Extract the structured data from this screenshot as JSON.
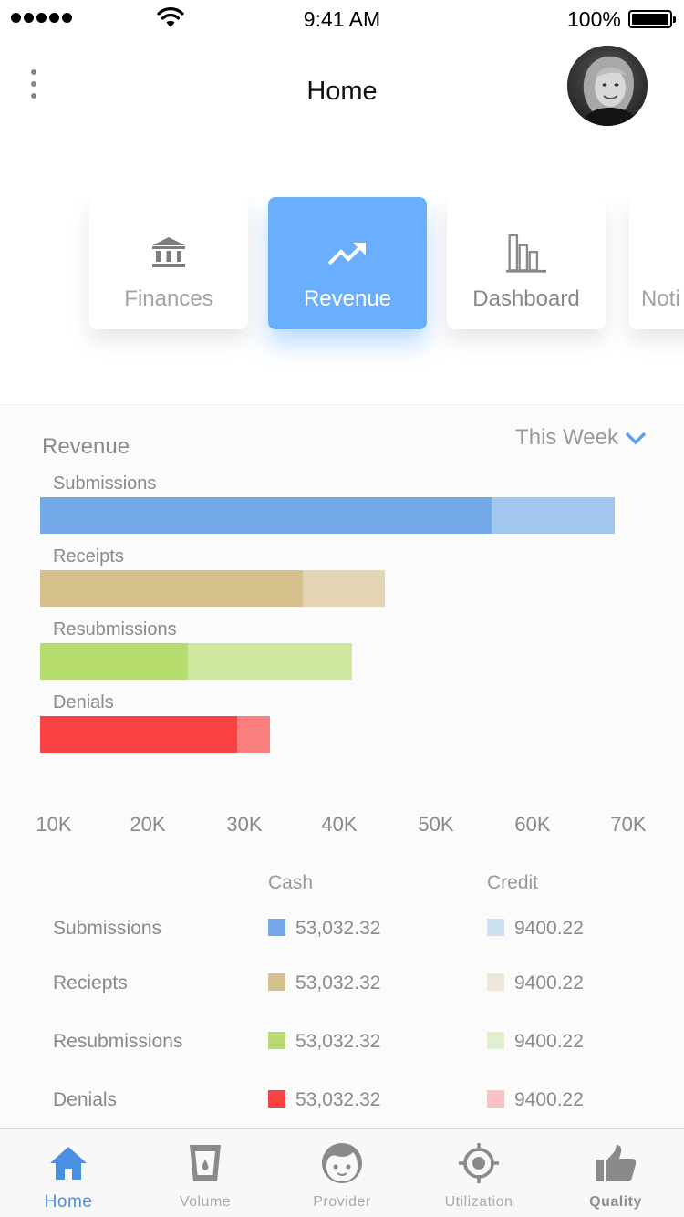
{
  "status_bar": {
    "time": "9:41 AM",
    "battery": "100%"
  },
  "header": {
    "title": "Home"
  },
  "categories": [
    {
      "label": "Finances",
      "icon": "bank-icon",
      "active": false
    },
    {
      "label": "Revenue",
      "icon": "trending-up-icon",
      "active": true
    },
    {
      "label": "Dashboard",
      "icon": "bar-chart-icon",
      "active": false
    },
    {
      "label": "Noti",
      "icon": "",
      "active": false
    }
  ],
  "panel": {
    "title": "Revenue",
    "period": "This Week"
  },
  "chart_data": {
    "type": "bar",
    "orientation": "horizontal",
    "stacked": true,
    "categories": [
      "Submissions",
      "Receipts",
      "Resubmissions",
      "Denials"
    ],
    "series": [
      {
        "name": "Cash",
        "values": [
          55,
          32,
          18,
          24
        ]
      },
      {
        "name": "Credit",
        "values": [
          15,
          10,
          20,
          4
        ]
      }
    ],
    "x_ticks": [
      "10K",
      "20K",
      "30K",
      "40K",
      "50K",
      "60K",
      "70K"
    ],
    "colors": {
      "cash": [
        "#74a9e8",
        "#d6c08c",
        "#b5dc6d",
        "#fb4242"
      ],
      "credit": [
        "#a3c6ef",
        "#e3d5b3",
        "#d0e7a0",
        "#fb7f7f"
      ]
    }
  },
  "legend": {
    "col_cash": "Cash",
    "col_credit": "Credit",
    "rows": [
      {
        "label": "Submissions",
        "cash": "53,032.32",
        "credit": "9400.22",
        "cash_color": "#74a9e8",
        "credit_color": "#cfe0f5"
      },
      {
        "label": "Reciepts",
        "cash": "53,032.32",
        "credit": "9400.22",
        "cash_color": "#d6c08c",
        "credit_color": "#eee8da"
      },
      {
        "label": "Resubmissions",
        "cash": "53,032.32",
        "credit": "9400.22",
        "cash_color": "#b5dc6d",
        "credit_color": "#e1efcd"
      },
      {
        "label": "Denials",
        "cash": "53,032.32",
        "credit": "9400.22",
        "cash_color": "#fb4242",
        "credit_color": "#fbc2c2"
      }
    ]
  },
  "tabs": [
    {
      "label": "Home",
      "icon": "home-icon",
      "active": true
    },
    {
      "label": "Volume",
      "icon": "cup-icon",
      "active": false
    },
    {
      "label": "Provider",
      "icon": "face-icon",
      "active": false
    },
    {
      "label": "Utilization",
      "icon": "target-icon",
      "active": false
    },
    {
      "label": "Quality",
      "icon": "thumbs-up-icon",
      "active": false
    }
  ],
  "accent_color": "#4a90e2"
}
